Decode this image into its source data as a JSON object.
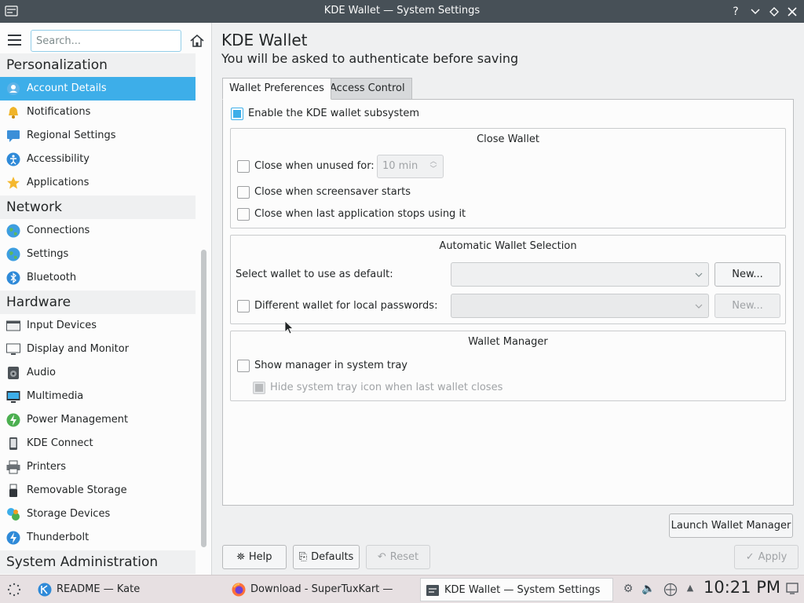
{
  "window": {
    "title": "KDE Wallet — System Settings"
  },
  "sidebar": {
    "search_placeholder": "Search...",
    "categories": [
      {
        "label": "Personalization"
      },
      {
        "label": "Network"
      },
      {
        "label": "Hardware"
      },
      {
        "label": "System Administration"
      }
    ],
    "personalization_items": [
      {
        "label": "Account Details",
        "icon": "user-icon"
      },
      {
        "label": "Notifications",
        "icon": "bell-icon"
      },
      {
        "label": "Regional Settings",
        "icon": "regional-icon"
      },
      {
        "label": "Accessibility",
        "icon": "accessibility-icon"
      },
      {
        "label": "Applications",
        "icon": "star-icon"
      }
    ],
    "network_items": [
      {
        "label": "Connections",
        "icon": "globe-icon"
      },
      {
        "label": "Settings",
        "icon": "globe-icon"
      },
      {
        "label": "Bluetooth",
        "icon": "bluetooth-icon"
      }
    ],
    "hardware_items": [
      {
        "label": "Input Devices",
        "icon": "keyboard-icon"
      },
      {
        "label": "Display and Monitor",
        "icon": "monitor-icon"
      },
      {
        "label": "Audio",
        "icon": "speaker-icon"
      },
      {
        "label": "Multimedia",
        "icon": "multimedia-icon"
      },
      {
        "label": "Power Management",
        "icon": "power-icon"
      },
      {
        "label": "KDE Connect",
        "icon": "phone-icon"
      },
      {
        "label": "Printers",
        "icon": "printer-icon"
      },
      {
        "label": "Removable Storage",
        "icon": "usb-icon"
      },
      {
        "label": "Storage Devices",
        "icon": "storage-icon"
      },
      {
        "label": "Thunderbolt",
        "icon": "thunderbolt-icon"
      }
    ]
  },
  "page": {
    "title": "KDE Wallet",
    "subtitle": "You will be asked to authenticate before saving",
    "tabs": [
      {
        "label": "Wallet Preferences"
      },
      {
        "label": "Access Control"
      }
    ],
    "enable_label": "Enable the KDE wallet subsystem",
    "close_wallet": {
      "title": "Close Wallet",
      "unused_label": "Close when unused for:",
      "unused_value": "10 min",
      "screensaver_label": "Close when screensaver starts",
      "last_app_label": "Close when last application stops using it"
    },
    "auto_selection": {
      "title": "Automatic Wallet Selection",
      "default_label": "Select wallet to use as default:",
      "local_label": "Different wallet for local passwords:",
      "new_label": "New...",
      "new_label_2": "New..."
    },
    "manager": {
      "title": "Wallet Manager",
      "show_label": "Show manager in system tray",
      "hide_label": "Hide system tray icon when last wallet closes"
    },
    "launch_label": "Launch Wallet Manager",
    "footer": {
      "help": "Help",
      "defaults": "Defaults",
      "reset": "Reset",
      "apply": "Apply"
    }
  },
  "taskbar": {
    "tasks": [
      {
        "label": "README  — Kate"
      },
      {
        "label": "Download - SuperTuxKart —"
      },
      {
        "label": "KDE Wallet  — System Settings"
      }
    ],
    "clock": "10:21 PM"
  }
}
